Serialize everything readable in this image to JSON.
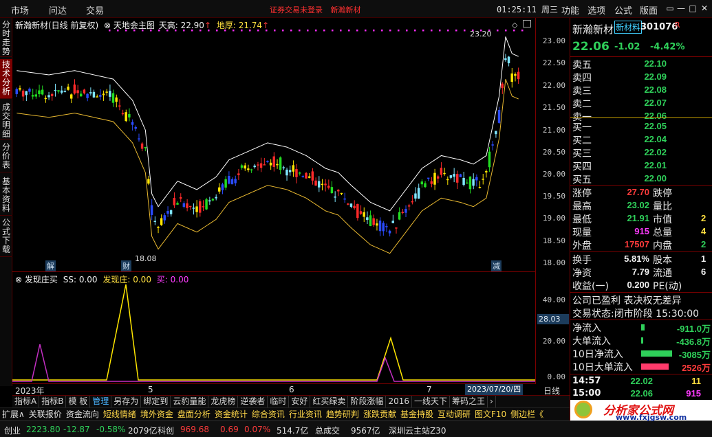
{
  "topbar": {
    "menu": [
      "市场",
      "问达",
      "交易"
    ],
    "status_login": "证券交易未登录",
    "status_stock": "新瀚新材",
    "clock": "01:25:11 周三",
    "right_menu": [
      "功能",
      "选项",
      "公式",
      "版面"
    ],
    "win_buttons": [
      "▭",
      "—",
      "□",
      "✕"
    ]
  },
  "left_tabs": [
    {
      "label": "分时走势",
      "active": false
    },
    {
      "label": "技术分析",
      "active": true
    },
    {
      "label": "成交明细",
      "active": false
    },
    {
      "label": "分价表",
      "active": false
    },
    {
      "label": "基本资料",
      "active": false
    },
    {
      "label": "公式下载",
      "active": false
    }
  ],
  "main_chart": {
    "title_stock": "新瀚新材(日线 前复权)",
    "title_indicator": "天地会主图",
    "label_tiangao": "天高: 22.90",
    "label_dihou": "地厚: 21.74",
    "max_label": "23.20",
    "min_label": "18.08",
    "marker_jie": "解",
    "marker_cai": "财",
    "marker_jian": "减",
    "colors": {
      "up": "#ff2a2a",
      "down": "#00c0ff",
      "green_down": "#22dd22",
      "yellow": "#ffe600",
      "cyan": "#7fe6ff",
      "blue": "#2a4bff",
      "upper": "#ffffff",
      "lower": "#e8b830",
      "magenta_dots": "#ff2bff"
    },
    "y_ticks": [
      "23.00",
      "22.50",
      "22.00",
      "21.50",
      "21.00",
      "20.50",
      "20.00",
      "19.50",
      "19.00",
      "18.50",
      "18.00"
    ]
  },
  "sub_chart": {
    "title_name": "发现庄买",
    "ss_label": "SS: 0.00",
    "fxz_label": "发现庄: 0.00",
    "buy_label": "买: 0.00",
    "current_value": "28.03",
    "y_ticks": [
      "40.00",
      "20.00",
      "0.00"
    ]
  },
  "x_axis": {
    "labels": [
      "2023年",
      "5",
      "6",
      "7"
    ],
    "date_highlight": "2023/07/20/四",
    "period": "日线"
  },
  "indicator_tabs": [
    "指标A",
    "指标B",
    "模 板",
    "管理",
    "另存为",
    "绑定到",
    "云豹量能",
    "龙虎榜",
    "逆袭者",
    "临时",
    "安好",
    "红买绿卖",
    "阶段涨幅",
    "2016",
    "一线天下",
    "筹码之王"
  ],
  "func_row": [
    {
      "label": "扩展∧",
      "yellow": false
    },
    {
      "label": "关联报价",
      "yellow": false
    },
    {
      "label": "资金流向",
      "yellow": false
    },
    {
      "label": "短线情绪",
      "yellow": true
    },
    {
      "label": "境外资金",
      "yellow": true
    },
    {
      "label": "盘面分析",
      "yellow": true
    },
    {
      "label": "资金统计",
      "yellow": true
    },
    {
      "label": "综合资讯",
      "yellow": true
    },
    {
      "label": "行业资讯",
      "yellow": true
    },
    {
      "label": "趋势研判",
      "yellow": true
    },
    {
      "label": "涨跌贡献",
      "yellow": true
    },
    {
      "label": "基金持股",
      "yellow": true
    },
    {
      "label": "互动调研",
      "yellow": true
    },
    {
      "label": "图文F10",
      "yellow": true
    },
    {
      "label": "侧边栏《",
      "yellow": true
    }
  ],
  "status_bar": {
    "index1_name": "创业",
    "index1_value": "2223.80",
    "index1_change": "-12.87",
    "index1_pct": "-0.58%",
    "index1_amount": "2079亿",
    "index2_name": "科创",
    "index2_value": "969.68",
    "index2_change": "0.69",
    "index2_pct": "0.07%",
    "index2_amount": "514.7亿",
    "total_label": "总成交",
    "total_value": "9567亿",
    "server": "深圳云主站Z30"
  },
  "right_panel": {
    "stock_name": "新瀚新材",
    "stock_badge": "新材料",
    "stock_code": "301076",
    "stock_flag": "R",
    "price": "22.06",
    "change": "-1.02",
    "change_pct": "-4.42%",
    "sells": [
      {
        "label": "卖五",
        "price": "22.10"
      },
      {
        "label": "卖四",
        "price": "22.09"
      },
      {
        "label": "卖三",
        "price": "22.08"
      },
      {
        "label": "卖二",
        "price": "22.07"
      },
      {
        "label": "卖一",
        "price": "22.06"
      }
    ],
    "buys": [
      {
        "label": "买一",
        "price": "22.05"
      },
      {
        "label": "买二",
        "price": "22.04"
      },
      {
        "label": "买三",
        "price": "22.02"
      },
      {
        "label": "买四",
        "price": "22.01"
      },
      {
        "label": "买五",
        "price": "22.00"
      }
    ],
    "stats": [
      {
        "l1": "涨停",
        "v1": "27.70",
        "c1": "red",
        "l2": "跌停",
        "v2": ""
      },
      {
        "l1": "最高",
        "v1": "23.02",
        "c1": "green",
        "l2": "量比",
        "v2": ""
      },
      {
        "l1": "最低",
        "v1": "21.91",
        "c1": "green",
        "l2": "市值",
        "v2": "2"
      },
      {
        "l1": "现量",
        "v1": "915",
        "c1": "magenta",
        "l2": "总量",
        "v2": "4"
      },
      {
        "l1": "外盘",
        "v1": "17507",
        "c1": "red",
        "l2": "内盘",
        "v2": "2"
      }
    ],
    "stats2": [
      {
        "l1": "换手",
        "v1": "5.81%",
        "l2": "股本",
        "v2": "1"
      },
      {
        "l1": "净资",
        "v1": "7.79",
        "l2": "流通",
        "v2": "6"
      },
      {
        "l1": "收益(一)",
        "v1": "0.200",
        "l2": "PE(动)",
        "v2": ""
      }
    ],
    "company_line1": "公司已盈利 表决权无差异",
    "company_line2_label": "交易状态:",
    "company_line2_value": "闭市阶段 15:30:00",
    "flows": [
      {
        "label": "净流入",
        "value": "-911.0万",
        "color": "green",
        "bar": 0.05
      },
      {
        "label": "大单流入",
        "value": "-436.8万",
        "color": "green",
        "bar": 0.03
      },
      {
        "label": "10日净流入",
        "value": "-3085万",
        "color": "green",
        "bar": 0.45
      },
      {
        "label": "10日大单流入",
        "value": "2526万",
        "color": "red",
        "bar": 0.4
      }
    ],
    "ticks": [
      {
        "time": "14:57",
        "price": "22.02",
        "vol": "11",
        "side": "S"
      },
      {
        "time": "15:00",
        "price": "22.06",
        "vol": "915",
        "side": "B"
      }
    ]
  },
  "logo": {
    "text": "分析家公式网",
    "url": "www.fxjgsw.com"
  }
}
